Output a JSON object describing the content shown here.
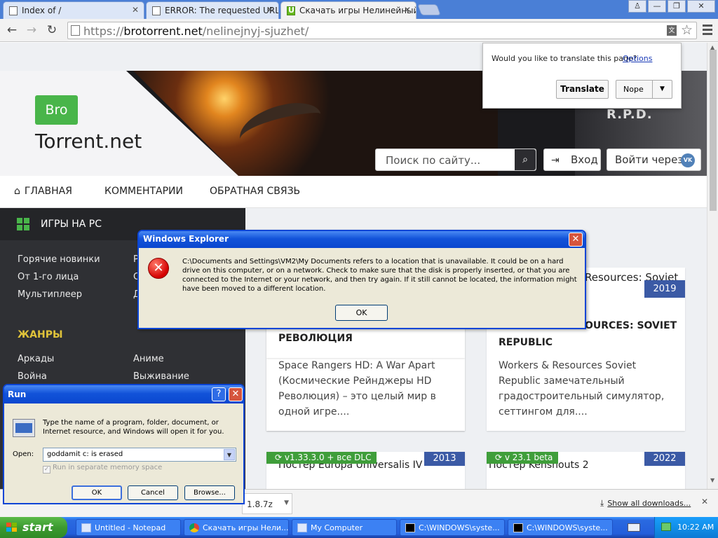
{
  "browser": {
    "tabs": [
      {
        "title": "Index of /",
        "active": false
      },
      {
        "title": "ERROR: The requested URL",
        "active": false
      },
      {
        "title": "Скачать игры Нелинейный",
        "active": true
      }
    ],
    "url_scheme": "https://",
    "url_host": "brotorrent.net",
    "url_path": "/nelinejnyj-sjuzhet/",
    "window_buttons": {
      "user": "♙",
      "minimize": "—",
      "restore": "❐",
      "close": "✕"
    }
  },
  "translate": {
    "question": "Would you like to translate this page?",
    "options": "Options",
    "translate_btn": "Translate",
    "nope_btn": "Nope"
  },
  "site": {
    "logo_badge": "Bro",
    "logo_text": "Torrent.net",
    "banner_sign": "R.P.D.",
    "search_placeholder": "Поиск по сайту...",
    "login": "Вход",
    "login_via": "Войти через",
    "vk": "VK",
    "nav": [
      "ГЛАВНАЯ",
      "КОММЕНТАРИИ",
      "ОБРАТНАЯ СВЯЗЬ"
    ],
    "sidebar_title": "ИГРЫ НА PC",
    "sidebar_links": [
      "Горячие новинки",
      "От 1-го лица",
      "Мультиплеер"
    ],
    "sidebar_links_right": [
      "Р",
      "С",
      "Д"
    ],
    "genres_title": "ЖАНРЫ",
    "genres_left": [
      "Аркады",
      "Война"
    ],
    "genres_right": [
      "Аниме",
      "Выживание"
    ]
  },
  "cards": [
    {
      "title_line1": "",
      "title_line2": "РЕВОЛЮЦИЯ",
      "text": [
        "Space Rangers HD: A War Apart",
        "(Космические Рейнджеры HD",
        "Революция) – это целый мир в",
        "одной игре...."
      ]
    },
    {
      "title_top": "Resources: Soviet",
      "year": "2019",
      "title_line1": "OURCES: SOVIET",
      "title_line2": "REPUBLIC",
      "text": [
        "Workers & Resources Soviet",
        "Republic замечательный",
        "градостроительный симулятор,",
        "сеттингом для...."
      ]
    }
  ],
  "cards_row2": [
    {
      "version": "v1.33.3.0 + все DLC",
      "year": "2013",
      "title": "Постер Europa Universalis IV"
    },
    {
      "version": "v 23.1 beta",
      "year": "2022",
      "title": "Постер Kenshouts 2"
    }
  ],
  "error_dialog": {
    "title": "Windows Explorer",
    "message": "C:\\Documents and Settings\\VM2\\My Documents refers to a location that is unavailable. It could be on a hard drive on this computer, or on a network. Check to make sure that the disk is properly inserted, or that you are connected to the Internet or your network, and then try again. If it still cannot be located, the information might have been moved to a different location.",
    "ok": "OK"
  },
  "run_dialog": {
    "title": "Run",
    "help": "?",
    "description": "Type the name of a program, folder, document, or Internet resource, and Windows will open it for you.",
    "open_label": "Open:",
    "open_value": "goddamit c: is erased",
    "separate_memory": "Run in separate memory space",
    "ok": "OK",
    "cancel": "Cancel",
    "browse": "Browse..."
  },
  "downloads": {
    "item": "1.8.7z",
    "show_all": "Show all downloads...",
    "close": "✕"
  },
  "taskbar": {
    "start": "start",
    "tasks": [
      {
        "label": "Untitled - Notepad",
        "icon": "notepad-icon"
      },
      {
        "label": "Скачать игры Нели...",
        "icon": "chrome-icon"
      },
      {
        "label": "My Computer",
        "icon": "computer-icon"
      },
      {
        "label": "C:\\WINDOWS\\syste...",
        "icon": "cmd-icon"
      },
      {
        "label": "C:\\WINDOWS\\syste...",
        "icon": "cmd-icon"
      }
    ],
    "clock": "10:22 AM"
  },
  "colors": {
    "brand_green": "#49b54a",
    "year_badge": "#3b5aa5",
    "xp_title_blue": "#0a47cf",
    "xp_start_green": "#3c9a30"
  }
}
